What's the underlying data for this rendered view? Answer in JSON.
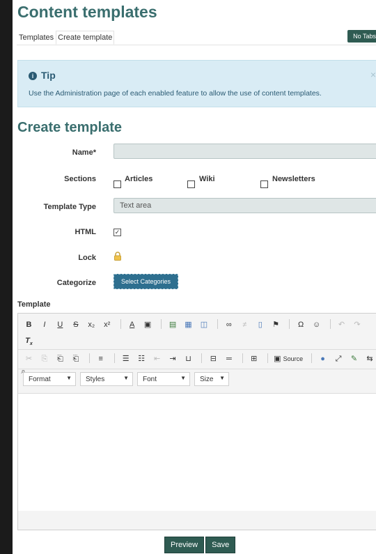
{
  "page_title": "Content templates",
  "tabs": [
    "Templates",
    "Create template"
  ],
  "no_tabs_label": "No Tabs",
  "tip": {
    "title": "Tip",
    "body": "Use the Administration page of each enabled feature to allow the use of content templates.",
    "close": "×"
  },
  "section_title": "Create template",
  "form": {
    "name_label": "Name",
    "name_required": "*",
    "name_value": "",
    "sections_label": "Sections",
    "sections": [
      "Articles",
      "Wiki",
      "Newsletters"
    ],
    "type_label": "Template Type",
    "type_value": "Text area",
    "html_label": "HTML",
    "html_checked": true,
    "lock_label": "Lock",
    "categorize_label": "Categorize",
    "categorize_button": "Select Categories"
  },
  "editor": {
    "label": "Template",
    "source_label": "Source",
    "format": "Format",
    "styles": "Styles",
    "font": "Font",
    "size": "Size"
  },
  "buttons": {
    "preview": "Preview",
    "save": "Save"
  }
}
